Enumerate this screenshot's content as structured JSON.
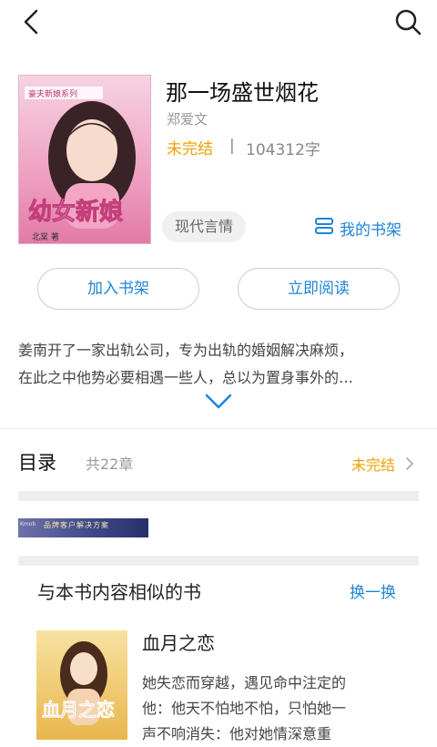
{
  "book": {
    "title": "那一场盛世烟花",
    "author": "郑爱文",
    "status": "未完结",
    "separator": "|",
    "word_count": "104312字",
    "genre": "现代言情",
    "my_shelf": "我的书架",
    "cover_series": "豪夫新娘系列",
    "cover_title": "幼女新娘",
    "cover_author": "北棠 著",
    "add_shelf": "加入书架",
    "read_now": "立即阅读",
    "description_lines": [
      "姜南开了一家出轨公司，专为出轨的婚姻解决麻烦，",
      "在此之中他势必要相遇一些人，总以为置身事外的…"
    ]
  },
  "toc": {
    "title": "目录",
    "count": "共22章",
    "status": "未完结"
  },
  "ad": {
    "text": "品牌客户解决方案",
    "tag": "Kmob"
  },
  "similar": {
    "title": "与本书内容相似的书",
    "refresh": "换一换",
    "book": {
      "title": "血月之恋",
      "cover_title": "血月之恋",
      "description_lines": [
        "她失恋而穿越，遇见命中注定的",
        "他：他天不怕地不怕，只怕她一",
        "声不响消失：他对她情深意重"
      ]
    }
  },
  "colors": {
    "accent_blue": "#1f85d6",
    "status_orange": "#f2a000"
  },
  "icons": {
    "back": "back-arrow-icon",
    "search": "search-icon",
    "shelf": "bookshelf-icon",
    "expand": "chevron-down-icon",
    "toc_arrow": "chevron-right-icon"
  }
}
